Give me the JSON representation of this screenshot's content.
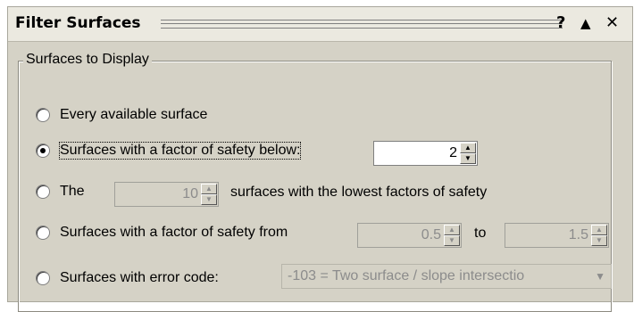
{
  "dialog": {
    "title": "Filter Surfaces",
    "help_label": "?",
    "collapse_label": "▲",
    "close_label": "✕"
  },
  "group": {
    "legend": "Surfaces to Display"
  },
  "options": {
    "every": {
      "label": "Every available surface",
      "selected": false
    },
    "below": {
      "label": "Surfaces with a factor of safety below:",
      "selected": true,
      "value": "2"
    },
    "lowest": {
      "prefix": "The",
      "value": "10",
      "suffix": "surfaces with the lowest factors of safety",
      "selected": false
    },
    "range": {
      "label": "Surfaces with a factor of safety from",
      "from": "0.5",
      "to_label": "to",
      "to": "1.5",
      "selected": false
    },
    "error": {
      "label": "Surfaces with error code:",
      "value": "-103 = Two surface / slope intersectio",
      "selected": false
    }
  },
  "icons": {
    "spin_up": "▲",
    "spin_down": "▼",
    "combo_arrow": "▼"
  }
}
